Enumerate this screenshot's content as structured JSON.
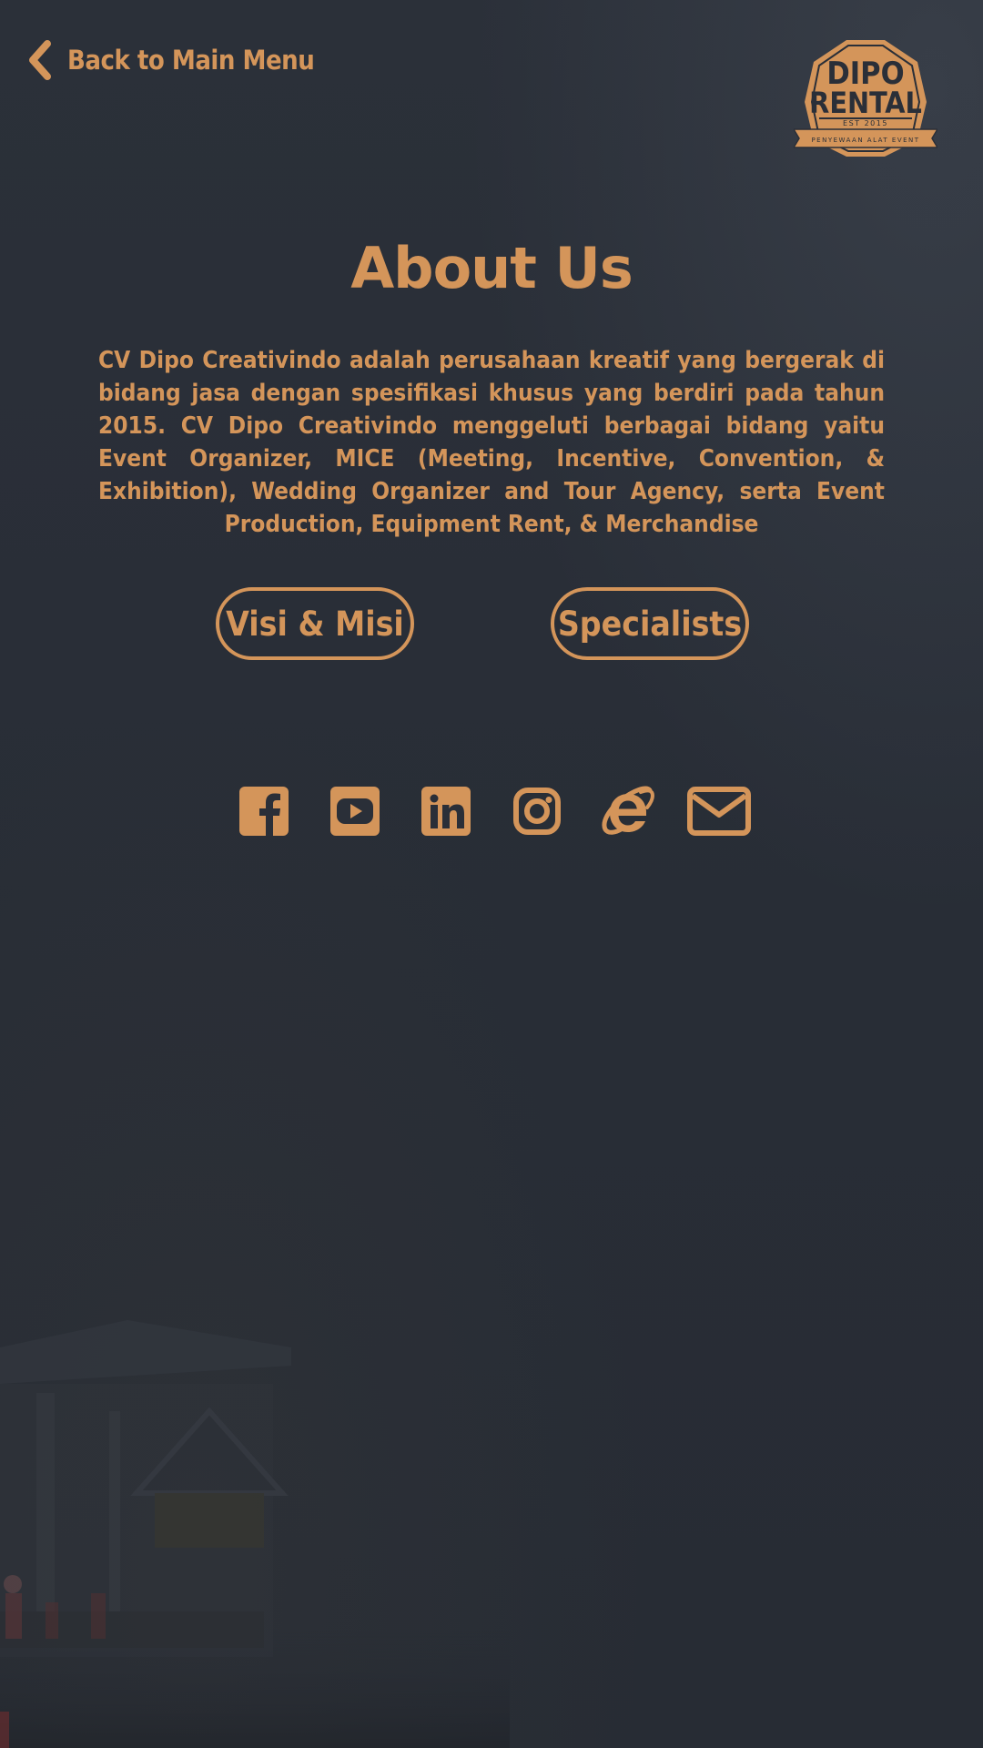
{
  "nav": {
    "back_label": "Back to Main Menu"
  },
  "logo": {
    "line1": "DIPO",
    "line2": "RENTAL",
    "est": "EST 2015",
    "tagline": "PENYEWAAN ALAT EVENT"
  },
  "page": {
    "title": "About Us",
    "description": "CV Dipo Creativindo adalah perusahaan kreatif yang bergerak di bidang jasa dengan spesifikasi khusus yang berdiri pada tahun 2015. CV Dipo Creativindo menggeluti berbagai bidang yaitu Event Organizer, MICE (Meeting, Incentive, Convention, & Exhibition), Wedding Organizer and Tour Agency, serta Event Production, Equipment Rent, & Merchandise"
  },
  "buttons": {
    "visi_label": "Visi & Misi",
    "specialists_label": "Specialists"
  },
  "social": {
    "icons": [
      "facebook-icon",
      "youtube-icon",
      "linkedin-icon",
      "instagram-icon",
      "internet-explorer-icon",
      "email-icon"
    ]
  },
  "colors": {
    "accent": "#d4955a",
    "background": "#2a2f38"
  }
}
